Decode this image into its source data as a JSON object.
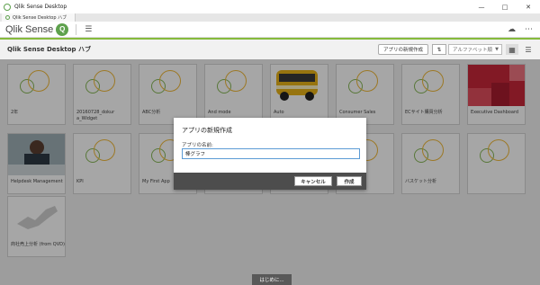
{
  "window": {
    "title": "Qlik Sense Desktop"
  },
  "tab": {
    "label": "Qlik Sense Desktop ハブ"
  },
  "header": {
    "logo_text": "Qlik Sense"
  },
  "subheader": {
    "title": "Qlik Sense Desktop ハブ",
    "create_label": "アプリの新規作成",
    "sort_value": "アルファベット順"
  },
  "apps": [
    {
      "label": "2年",
      "thumb": "rings"
    },
    {
      "label": "20160728_dokur a_Widget",
      "thumb": "rings"
    },
    {
      "label": "ABC分析",
      "thumb": "rings"
    },
    {
      "label": "And mode",
      "thumb": "rings"
    },
    {
      "label": "Auto",
      "thumb": "bus"
    },
    {
      "label": "Consumer Sales",
      "thumb": "rings"
    },
    {
      "label": "ECサイト購買分析",
      "thumb": "rings"
    },
    {
      "label": "Executive Dashboard",
      "thumb": "heatmap"
    },
    {
      "label": "Helpdesk Management",
      "thumb": "photo"
    },
    {
      "label": "KPI",
      "thumb": "rings"
    },
    {
      "label": "My First App",
      "thumb": "rings"
    },
    {
      "label": "",
      "thumb": "rings"
    },
    {
      "label": "",
      "thumb": "rings"
    },
    {
      "label": "あ",
      "thumb": "rings"
    },
    {
      "label": "バスケット分析",
      "thumb": "rings"
    },
    {
      "label": "",
      "thumb": "rings"
    },
    {
      "label": "商社売上分析 (from QVD)",
      "thumb": "map"
    }
  ],
  "dialog": {
    "title": "アプリの新規作成",
    "name_label": "アプリの名前:",
    "name_value": "棒グラフ",
    "cancel_label": "キャンセル",
    "create_label": "作成"
  },
  "footer": {
    "start_label": "はじめに..."
  }
}
